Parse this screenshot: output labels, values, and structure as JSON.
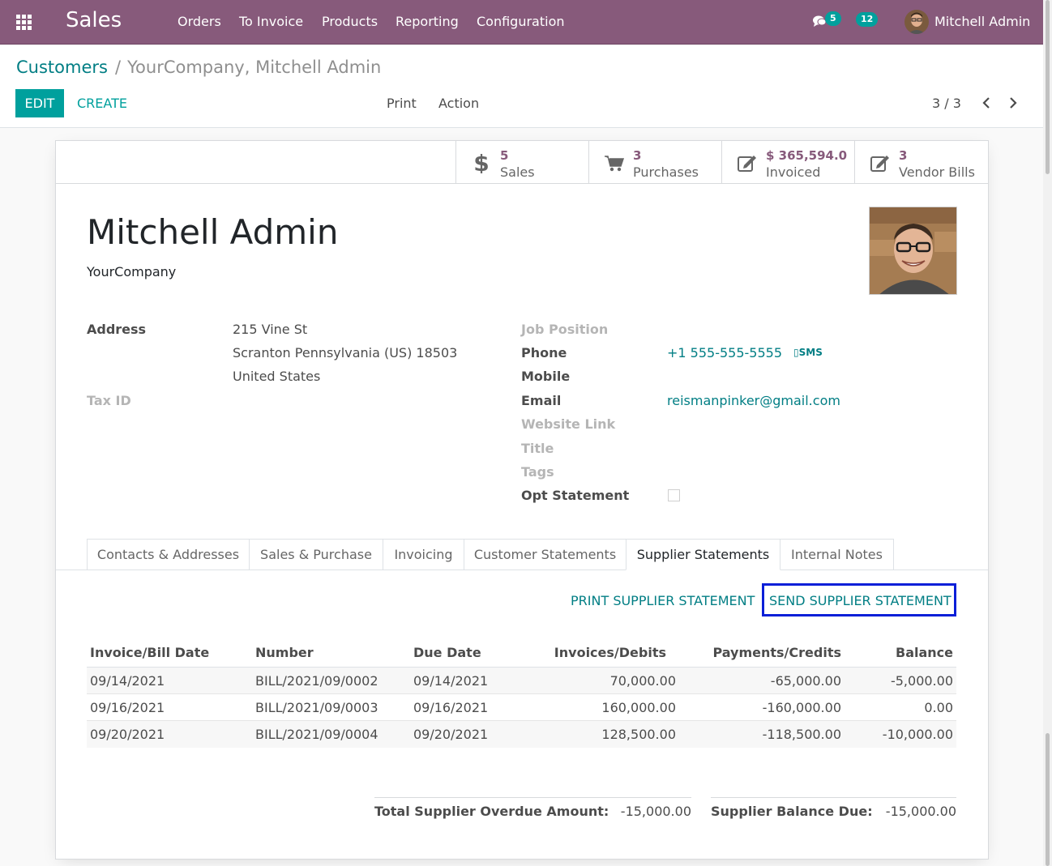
{
  "navbar": {
    "brand": "Sales",
    "menu": [
      "Orders",
      "To Invoice",
      "Products",
      "Reporting",
      "Configuration"
    ],
    "messages_count": "5",
    "activities_count": "12",
    "user": "Mitchell Admin"
  },
  "breadcrumb": {
    "parent": "Customers",
    "separator": "/",
    "current": "YourCompany, Mitchell Admin"
  },
  "toolbar": {
    "edit_label": "EDIT",
    "create_label": "CREATE",
    "print_label": "Print",
    "action_label": "Action",
    "pager": "3 / 3"
  },
  "stat_buttons": [
    {
      "value": "5",
      "label": "Sales",
      "icon": "dollar-icon"
    },
    {
      "value": "3",
      "label": "Purchases",
      "icon": "cart-icon"
    },
    {
      "value": "$ 365,594.0",
      "label": "Invoiced",
      "icon": "edit-icon"
    },
    {
      "value": "3",
      "label": "Vendor Bills",
      "icon": "edit-icon"
    }
  ],
  "partner": {
    "name": "Mitchell Admin",
    "company": "YourCompany",
    "address_label": "Address",
    "street": "215 Vine St",
    "city_line": "Scranton Pennsylvania (US) 18503",
    "country": "United States",
    "tax_id_label": "Tax ID",
    "job_position_label": "Job Position",
    "phone_label": "Phone",
    "phone": "+1 555-555-5555",
    "sms_label": "SMS",
    "mobile_label": "Mobile",
    "email_label": "Email",
    "email": "reismanpinker@gmail.com",
    "website_label": "Website Link",
    "title_label": "Title",
    "tags_label": "Tags",
    "opt_statement_label": "Opt Statement"
  },
  "tabs": [
    "Contacts & Addresses",
    "Sales & Purchase",
    "Invoicing",
    "Customer Statements",
    "Supplier Statements",
    "Internal Notes"
  ],
  "active_tab": "Supplier Statements",
  "statement": {
    "print_label": "PRINT SUPPLIER STATEMENT",
    "send_label": "SEND SUPPLIER STATEMENT",
    "columns": [
      "Invoice/Bill Date",
      "Number",
      "Due Date",
      "Invoices/Debits",
      "Payments/Credits",
      "Balance"
    ],
    "rows": [
      [
        "09/14/2021",
        "BILL/2021/09/0002",
        "09/14/2021",
        "70,000.00",
        "-65,000.00",
        "-5,000.00"
      ],
      [
        "09/16/2021",
        "BILL/2021/09/0003",
        "09/16/2021",
        "160,000.00",
        "-160,000.00",
        "0.00"
      ],
      [
        "09/20/2021",
        "BILL/2021/09/0004",
        "09/20/2021",
        "128,500.00",
        "-118,500.00",
        "-10,000.00"
      ]
    ],
    "overdue_label": "Total Supplier Overdue Amount:",
    "overdue_value": "-15,000.00",
    "balance_label": "Supplier Balance Due:",
    "balance_value": "-15,000.00"
  },
  "colors": {
    "navbar": "#875a7b",
    "primary": "#00a09d",
    "link": "#017e84",
    "highlight_box": "#0a1fd8"
  }
}
